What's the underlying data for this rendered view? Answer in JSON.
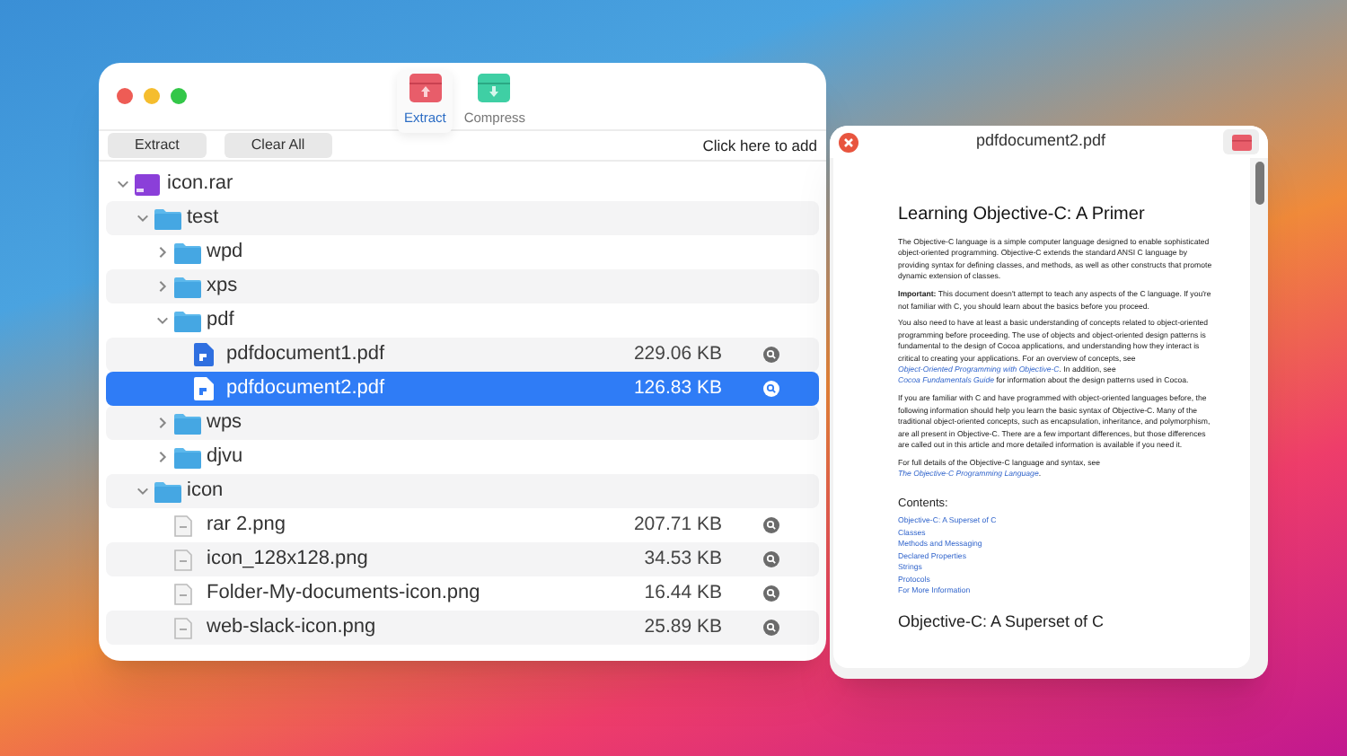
{
  "main_window": {
    "tabs": [
      {
        "label": "Extract",
        "kind": "extract",
        "selected": true
      },
      {
        "label": "Compress",
        "kind": "compress",
        "selected": false
      }
    ],
    "toolbar": {
      "buttons": [
        "Extract",
        "Clear All"
      ],
      "add_link": "Click here to add"
    },
    "tree": [
      {
        "name": "icon.rar",
        "kind": "archive",
        "expanded": true,
        "selected": false,
        "children": [
          {
            "name": "test",
            "kind": "folder",
            "expanded": true,
            "selected": false,
            "children": [
              {
                "name": "wpd",
                "kind": "folder",
                "expanded": false,
                "selected": false
              },
              {
                "name": "xps",
                "kind": "folder",
                "expanded": false,
                "selected": false
              },
              {
                "name": "pdf",
                "kind": "folder",
                "expanded": true,
                "selected": false,
                "children": [
                  {
                    "name": "pdfdocument1.pdf",
                    "kind": "pdf",
                    "size": "229.06 KB",
                    "selected": false
                  },
                  {
                    "name": "pdfdocument2.pdf",
                    "kind": "pdf",
                    "size": "126.83 KB",
                    "selected": true
                  }
                ]
              },
              {
                "name": "wps",
                "kind": "folder",
                "expanded": false,
                "selected": false
              },
              {
                "name": "djvu",
                "kind": "folder",
                "expanded": false,
                "selected": false
              }
            ]
          },
          {
            "name": "icon",
            "kind": "folder",
            "expanded": true,
            "selected": false,
            "children": [
              {
                "name": "rar 2.png",
                "kind": "image",
                "size": "207.71 KB",
                "selected": false
              },
              {
                "name": "icon_128x128.png",
                "kind": "image",
                "size": "34.53 KB",
                "selected": false
              },
              {
                "name": "Folder-My-documents-icon.png",
                "kind": "image",
                "size": "16.44 KB",
                "selected": false
              },
              {
                "name": "web-slack-icon.png",
                "kind": "image",
                "size": "25.89 KB",
                "selected": false
              }
            ]
          }
        ]
      }
    ]
  },
  "preview_window": {
    "title": "pdfdocument2.pdf",
    "document": {
      "heading": "Learning Objective-C: A Primer",
      "paragraphs": [
        [
          {
            "kind": "text",
            "text": "The Objective-C language is a simple computer language designed to enable sophisticated object-oriented programming. Objective-C extends the standard ANSI C language by providing syntax for defining classes, and methods, as well as other constructs that promote dynamic extension of classes."
          }
        ],
        [
          {
            "kind": "text",
            "text": "**Important:** This document doesn't attempt to teach any aspects of the C language. If you're not familiar with C, you should learn about the basics before you proceed."
          }
        ],
        [
          {
            "kind": "text",
            "text": "You also need to have at least a basic understanding of concepts related to object-oriented programming before proceeding. The use of objects and object-oriented design patterns is fundamental to the design of Cocoa applications, and understanding how they interact is critical to creating your applications. For an overview of concepts, see"
          },
          {
            "kind": "link",
            "text": "Object-Oriented Programming with Objective-C"
          },
          {
            "kind": "text",
            "text": ". In addition, see"
          },
          {
            "kind": "link",
            "text": "Cocoa Fundamentals Guide"
          },
          {
            "kind": "text",
            "text": "for information about the design patterns used in Cocoa."
          }
        ],
        [
          {
            "kind": "text",
            "text": "If you are familiar with C and have programmed with object-oriented languages before, the following information should help you learn the basic syntax of Objective-C. Many of the traditional object-oriented concepts, such as encapsulation, inheritance, and polymorphism, are all present in Objective-C. There are a few important differences, but those differences are called out in this article and more detailed information is available if you need it."
          }
        ],
        [
          {
            "kind": "text",
            "text": "For full details of the Objective-C language and syntax, see"
          },
          {
            "kind": "link",
            "text": "The Objective-C Programming Language"
          },
          {
            "kind": "text",
            "text": "."
          }
        ]
      ],
      "contents_title": "Contents:",
      "contents": [
        "Objective-C: A Superset of C",
        "Classes",
        "Methods and Messaging",
        "Declared Properties",
        "Strings",
        "Protocols",
        "For More Information"
      ],
      "next_heading": "Objective-C: A Superset of C"
    }
  }
}
